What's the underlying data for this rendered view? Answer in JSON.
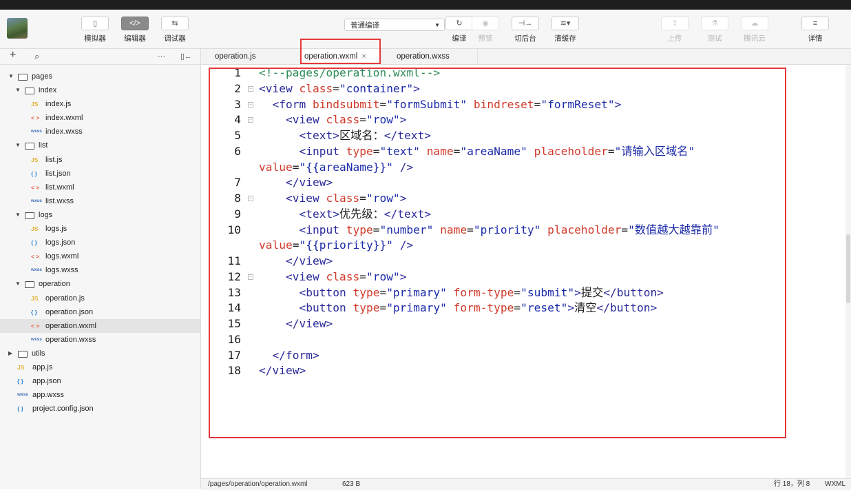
{
  "toolbar": {
    "simulator": {
      "label": "模拟器",
      "icon": "phone-icon"
    },
    "editor": {
      "label": "编辑器",
      "icon": "code-icon"
    },
    "debugger": {
      "label": "调试器",
      "icon": "debug-icon"
    },
    "compile_mode": "普通编译",
    "compile": {
      "label": "编译",
      "icon": "refresh-icon"
    },
    "preview": {
      "label": "预览",
      "icon": "eye-icon"
    },
    "backstage": {
      "label": "切后台",
      "icon": "switch-background-icon"
    },
    "clear_cache": {
      "label": "清缓存",
      "icon": "layers-icon"
    },
    "upload": {
      "label": "上传",
      "icon": "upload-icon"
    },
    "test": {
      "label": "测试",
      "icon": "flask-icon"
    },
    "tencent_cloud": {
      "label": "腾讯云",
      "icon": "cloud-icon"
    },
    "details": {
      "label": "详情",
      "icon": "menu-icon"
    }
  },
  "sidebar": {
    "add": "+",
    "search": "⌕",
    "more": "···",
    "collapse": "▯←",
    "tree": [
      {
        "name": "pages",
        "type": "folder",
        "depth": 0,
        "open": true
      },
      {
        "name": "index",
        "type": "folder",
        "depth": 1,
        "open": true
      },
      {
        "name": "index.js",
        "type": "js",
        "depth": 2
      },
      {
        "name": "index.wxml",
        "type": "wxml",
        "depth": 2
      },
      {
        "name": "index.wxss",
        "type": "wxss",
        "depth": 2
      },
      {
        "name": "list",
        "type": "folder",
        "depth": 1,
        "open": true
      },
      {
        "name": "list.js",
        "type": "js",
        "depth": 2
      },
      {
        "name": "list.json",
        "type": "json",
        "depth": 2
      },
      {
        "name": "list.wxml",
        "type": "wxml",
        "depth": 2
      },
      {
        "name": "list.wxss",
        "type": "wxss",
        "depth": 2
      },
      {
        "name": "logs",
        "type": "folder",
        "depth": 1,
        "open": true
      },
      {
        "name": "logs.js",
        "type": "js",
        "depth": 2
      },
      {
        "name": "logs.json",
        "type": "json",
        "depth": 2
      },
      {
        "name": "logs.wxml",
        "type": "wxml",
        "depth": 2
      },
      {
        "name": "logs.wxss",
        "type": "wxss",
        "depth": 2
      },
      {
        "name": "operation",
        "type": "folder",
        "depth": 1,
        "open": true
      },
      {
        "name": "operation.js",
        "type": "js",
        "depth": 2
      },
      {
        "name": "operation.json",
        "type": "json",
        "depth": 2
      },
      {
        "name": "operation.wxml",
        "type": "wxml",
        "depth": 2,
        "selected": true
      },
      {
        "name": "operation.wxss",
        "type": "wxss",
        "depth": 2
      },
      {
        "name": "utils",
        "type": "folder",
        "depth": 0,
        "open": false
      },
      {
        "name": "app.js",
        "type": "js",
        "depth": 0
      },
      {
        "name": "app.json",
        "type": "json",
        "depth": 0
      },
      {
        "name": "app.wxss",
        "type": "wxss",
        "depth": 0
      },
      {
        "name": "project.config.json",
        "type": "json",
        "depth": 0
      }
    ],
    "file_icons": {
      "js": "JS",
      "json": "{ }",
      "wxml": "< >",
      "wxss": "wxss"
    }
  },
  "tabs": [
    {
      "label": "operation.js",
      "active": false
    },
    {
      "label": "operation.wxml",
      "active": true,
      "close": "×"
    },
    {
      "label": "operation.wxss",
      "active": false
    }
  ],
  "editor": {
    "lines": [
      {
        "n": "1",
        "fold": false,
        "tokens": [
          [
            "c",
            "<!--pages/operation.wxml-->"
          ]
        ]
      },
      {
        "n": "2",
        "fold": true,
        "tokens": [
          [
            "t",
            "<view "
          ],
          [
            "a",
            "class"
          ],
          [
            "p",
            "="
          ],
          [
            "s",
            "\"container\""
          ],
          [
            "t",
            ">"
          ]
        ]
      },
      {
        "n": "3",
        "fold": true,
        "tokens": [
          [
            "p",
            "  "
          ],
          [
            "t",
            "<form "
          ],
          [
            "a",
            "bindsubmit"
          ],
          [
            "p",
            "="
          ],
          [
            "s",
            "\"formSubmit\""
          ],
          [
            "p",
            " "
          ],
          [
            "a",
            "bindreset"
          ],
          [
            "p",
            "="
          ],
          [
            "s",
            "\"formReset\""
          ],
          [
            "t",
            ">"
          ]
        ]
      },
      {
        "n": "4",
        "fold": true,
        "tokens": [
          [
            "p",
            "    "
          ],
          [
            "t",
            "<view "
          ],
          [
            "a",
            "class"
          ],
          [
            "p",
            "="
          ],
          [
            "s",
            "\"row\""
          ],
          [
            "t",
            ">"
          ]
        ]
      },
      {
        "n": "5",
        "fold": false,
        "tokens": [
          [
            "p",
            "      "
          ],
          [
            "t",
            "<text>"
          ],
          [
            "p",
            "区域名："
          ],
          [
            "t",
            "</text>"
          ]
        ]
      },
      {
        "n": "6",
        "fold": false,
        "tokens": [
          [
            "p",
            "      "
          ],
          [
            "t",
            "<input "
          ],
          [
            "a",
            "type"
          ],
          [
            "p",
            "="
          ],
          [
            "s",
            "\"text\""
          ],
          [
            "p",
            " "
          ],
          [
            "a",
            "name"
          ],
          [
            "p",
            "="
          ],
          [
            "s",
            "\"areaName\""
          ],
          [
            "p",
            " "
          ],
          [
            "a",
            "placeholder"
          ],
          [
            "p",
            "="
          ],
          [
            "s",
            "\"请输入区域名\""
          ]
        ]
      },
      {
        "n": "",
        "fold": false,
        "wrap": true,
        "tokens": [
          [
            "a",
            "value"
          ],
          [
            "p",
            "="
          ],
          [
            "s",
            "\"{{areaName}}\""
          ],
          [
            "p",
            " "
          ],
          [
            "t",
            "/>"
          ]
        ]
      },
      {
        "n": "7",
        "fold": false,
        "tokens": [
          [
            "p",
            "    "
          ],
          [
            "t",
            "</view>"
          ]
        ]
      },
      {
        "n": "8",
        "fold": true,
        "tokens": [
          [
            "p",
            "    "
          ],
          [
            "t",
            "<view "
          ],
          [
            "a",
            "class"
          ],
          [
            "p",
            "="
          ],
          [
            "s",
            "\"row\""
          ],
          [
            "t",
            ">"
          ]
        ]
      },
      {
        "n": "9",
        "fold": false,
        "tokens": [
          [
            "p",
            "      "
          ],
          [
            "t",
            "<text>"
          ],
          [
            "p",
            "优先级："
          ],
          [
            "t",
            "</text>"
          ]
        ]
      },
      {
        "n": "10",
        "fold": false,
        "tokens": [
          [
            "p",
            "      "
          ],
          [
            "t",
            "<input "
          ],
          [
            "a",
            "type"
          ],
          [
            "p",
            "="
          ],
          [
            "s",
            "\"number\""
          ],
          [
            "p",
            " "
          ],
          [
            "a",
            "name"
          ],
          [
            "p",
            "="
          ],
          [
            "s",
            "\"priority\""
          ],
          [
            "p",
            " "
          ],
          [
            "a",
            "placeholder"
          ],
          [
            "p",
            "="
          ],
          [
            "s",
            "\"数值越大越靠前\""
          ]
        ]
      },
      {
        "n": "",
        "fold": false,
        "wrap": true,
        "tokens": [
          [
            "a",
            "value"
          ],
          [
            "p",
            "="
          ],
          [
            "s",
            "\"{{priority}}\""
          ],
          [
            "p",
            " "
          ],
          [
            "t",
            "/>"
          ]
        ]
      },
      {
        "n": "11",
        "fold": false,
        "tokens": [
          [
            "p",
            "    "
          ],
          [
            "t",
            "</view>"
          ]
        ]
      },
      {
        "n": "12",
        "fold": true,
        "tokens": [
          [
            "p",
            "    "
          ],
          [
            "t",
            "<view "
          ],
          [
            "a",
            "class"
          ],
          [
            "p",
            "="
          ],
          [
            "s",
            "\"row\""
          ],
          [
            "t",
            ">"
          ]
        ]
      },
      {
        "n": "13",
        "fold": false,
        "tokens": [
          [
            "p",
            "      "
          ],
          [
            "t",
            "<button "
          ],
          [
            "a",
            "type"
          ],
          [
            "p",
            "="
          ],
          [
            "s",
            "\"primary\""
          ],
          [
            "p",
            " "
          ],
          [
            "a",
            "form-type"
          ],
          [
            "p",
            "="
          ],
          [
            "s",
            "\"submit\""
          ],
          [
            "t",
            ">"
          ],
          [
            "p",
            "提交"
          ],
          [
            "t",
            "</button>"
          ]
        ]
      },
      {
        "n": "14",
        "fold": false,
        "tokens": [
          [
            "p",
            "      "
          ],
          [
            "t",
            "<button "
          ],
          [
            "a",
            "type"
          ],
          [
            "p",
            "="
          ],
          [
            "s",
            "\"primary\""
          ],
          [
            "p",
            " "
          ],
          [
            "a",
            "form-type"
          ],
          [
            "p",
            "="
          ],
          [
            "s",
            "\"reset\""
          ],
          [
            "t",
            ">"
          ],
          [
            "p",
            "清空"
          ],
          [
            "t",
            "</button>"
          ]
        ]
      },
      {
        "n": "15",
        "fold": false,
        "tokens": [
          [
            "p",
            "    "
          ],
          [
            "t",
            "</view>"
          ]
        ]
      },
      {
        "n": "16",
        "fold": false,
        "tokens": [
          [
            "p",
            ""
          ]
        ]
      },
      {
        "n": "17",
        "fold": false,
        "tokens": [
          [
            "p",
            "  "
          ],
          [
            "t",
            "</form>"
          ]
        ]
      },
      {
        "n": "18",
        "fold": false,
        "tokens": [
          [
            "t",
            "</view>"
          ]
        ]
      }
    ]
  },
  "status": {
    "path": "/pages/operation/operation.wxml",
    "size": "623 B",
    "cursor": "行 18，列 8",
    "language": "WXML"
  },
  "colors": {
    "highlight": "#e5383b",
    "tag": "#2a2a9a",
    "attribute": "#d03a2a",
    "string": "#1b2aa8",
    "comment": "#2e8b57"
  }
}
